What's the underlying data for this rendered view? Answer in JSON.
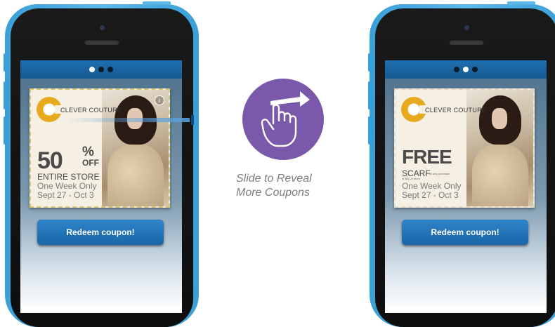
{
  "colors": {
    "phone_frame": "#3a9fd8",
    "screen_bar": "#1f6fb0",
    "coupon_accent": "#e7a91d",
    "hint_circle": "#7a59aa",
    "button": "#1866a9"
  },
  "icons": {
    "swipe": "hand-pointer-swipe-icon",
    "info": "info-icon",
    "brand_logo": "clever-couture-logo"
  },
  "left_phone": {
    "brand": "CLEVER COUTURE",
    "headline_number": "50",
    "headline_percent": "%",
    "headline_suffix": "OFF",
    "line1": "ENTIRE STORE",
    "line2": "One Week Only",
    "line3": "Sept 27 - Oct 3",
    "info": "i",
    "button_label": "Redeem coupon!"
  },
  "right_phone": {
    "brand": "CLEVER COUTURE",
    "headline": "FREE",
    "item": "SCARF",
    "item_note": "w/ any purchase",
    "item_note2": "of $50 or more",
    "line2": "One Week Only",
    "line3": "Sept 27 - Oct 3",
    "button_label": "Redeem coupon!"
  },
  "hint": {
    "line1": "Slide to Reveal",
    "line2": "More Coupons"
  }
}
